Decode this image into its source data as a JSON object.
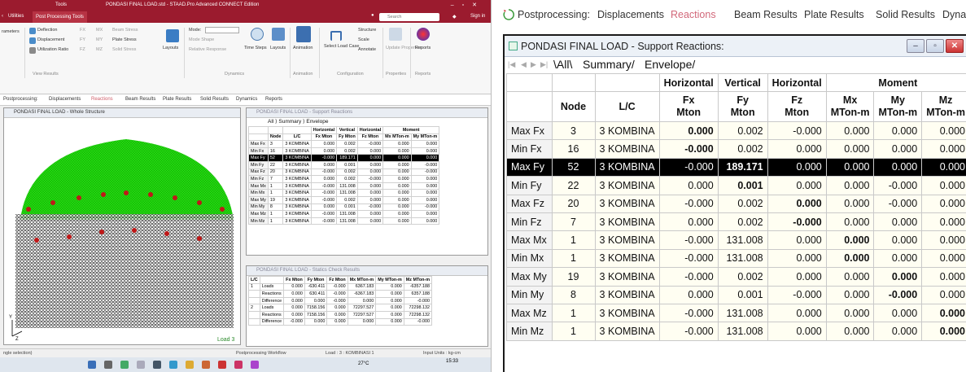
{
  "left": {
    "titlebar": {
      "tools_label": "Tools",
      "title": "PONDASI FINAL LOAD.std - STAAD.Pro Advanced CONNECT Edition"
    },
    "menubar": {
      "utilities": "Utilities",
      "post_processing_tools": "Post Processing Tools",
      "search_placeholder": "Search",
      "sign_in": "Sign in"
    },
    "ribbon": {
      "parameters": "rameters",
      "deflection": "Deflection",
      "displacement": "Displacement",
      "utilization_ratio": "Utilization Ratio",
      "fx": "FX",
      "fy": "FY",
      "mx": "MX",
      "my": "MY",
      "fz": "FZ",
      "mz": "MZ",
      "beam_stress": "Beam Stress",
      "plate_stress": "Plate Stress",
      "solid_stress": "Solid Stress",
      "layouts": "Layouts",
      "mode_label": "Mode:",
      "mode_shape": "Mode Shape",
      "relative_response": "Relative Response",
      "time_steps": "Time Steps",
      "layouts2": "Layouts",
      "animation": "Animation",
      "select_load_case": "Select Load Case",
      "structure": "Structure",
      "scale": "Scale",
      "annotate": "Annotate",
      "update_properties": "Update Properties",
      "reports": "Reports",
      "group_view_results": "View Results",
      "group_dynamics": "Dynamics",
      "group_animation": "Animation",
      "group_configuration": "Configuration",
      "group_properties": "Properties",
      "group_reports": "Reports"
    },
    "subtabs": [
      "Postprocessing:",
      "Displacements",
      "Reactions",
      "Beam Results",
      "Plate Results",
      "Solid Results",
      "Dynamics",
      "Reports"
    ],
    "struct_window_title": "PONDASI FINAL LOAD - Whole Structure",
    "struct_load_label": "Load 3",
    "struct_axis_label": "Y",
    "struct_axis_label2": "Z",
    "react_small_title": "PONDASI FINAL LOAD - Support Reactions",
    "react_small_rows": [
      {
        "label": "Max Fx",
        "node": "3",
        "lc": "3 KOMBINA",
        "fx": "0.000",
        "fy": "0.002",
        "fz": "-0.000",
        "mx": "0.000",
        "my": "0.000"
      },
      {
        "label": "Min Fx",
        "node": "16",
        "lc": "3 KOMBINA",
        "fx": "0.000",
        "fy": "0.002",
        "fz": "0.000",
        "mx": "0.000",
        "my": "0.000"
      },
      {
        "label": "Max Fy",
        "node": "52",
        "lc": "3 KOMBINA",
        "fx": "-0.000",
        "fy": "189.171",
        "fz": "0.000",
        "mx": "0.000",
        "my": "0.000"
      },
      {
        "label": "Min Fy",
        "node": "22",
        "lc": "3 KOMBINA",
        "fx": "0.000",
        "fy": "0.001",
        "fz": "0.000",
        "mx": "0.000",
        "my": "-0.000"
      },
      {
        "label": "Max Fz",
        "node": "20",
        "lc": "3 KOMBINA",
        "fx": "-0.000",
        "fy": "0.002",
        "fz": "0.000",
        "mx": "0.000",
        "my": "-0.000"
      },
      {
        "label": "Min Fz",
        "node": "7",
        "lc": "3 KOMBINA",
        "fx": "0.000",
        "fy": "0.002",
        "fz": "-0.000",
        "mx": "0.000",
        "my": "0.000"
      },
      {
        "label": "Max Mx",
        "node": "1",
        "lc": "3 KOMBINA",
        "fx": "-0.000",
        "fy": "131.008",
        "fz": "0.000",
        "mx": "0.000",
        "my": "0.000"
      },
      {
        "label": "Min Mx",
        "node": "1",
        "lc": "3 KOMBINA",
        "fx": "-0.000",
        "fy": "131.008",
        "fz": "0.000",
        "mx": "0.000",
        "my": "0.000"
      },
      {
        "label": "Max My",
        "node": "19",
        "lc": "3 KOMBINA",
        "fx": "-0.000",
        "fy": "0.002",
        "fz": "0.000",
        "mx": "0.000",
        "my": "0.000"
      },
      {
        "label": "Min My",
        "node": "8",
        "lc": "3 KOMBINA",
        "fx": "0.000",
        "fy": "0.001",
        "fz": "-0.000",
        "mx": "0.000",
        "my": "-0.000"
      },
      {
        "label": "Max Mz",
        "node": "1",
        "lc": "3 KOMBINA",
        "fx": "-0.000",
        "fy": "131.008",
        "fz": "0.000",
        "mx": "0.000",
        "my": "0.000"
      },
      {
        "label": "Min Mz",
        "node": "1",
        "lc": "3 KOMBINA",
        "fx": "-0.000",
        "fy": "131.008",
        "fz": "0.000",
        "mx": "0.000",
        "my": "0.000"
      }
    ],
    "statics_title": "PONDASI FINAL LOAD - Statics Check Results",
    "statics_headers": [
      "L/C",
      "",
      "Fx Mton",
      "Fy Mton",
      "Fz Mton",
      "Mx MTon-m",
      "My MTon-m",
      "Mz MTon-m"
    ],
    "statics_rows": [
      {
        "lc": "1",
        "type": "Loads",
        "fx": "0.000",
        "fy": "-630.411",
        "fz": "-0.000",
        "mx": "6367.183",
        "my": "0.000",
        "mz": "-6357.188"
      },
      {
        "lc": "",
        "type": "Reactions",
        "fx": "0.000",
        "fy": "630.411",
        "fz": "-0.000",
        "mx": "-6367.183",
        "my": "0.000",
        "mz": "6357.188"
      },
      {
        "lc": "",
        "type": "Difference",
        "fx": "0.000",
        "fy": "0.000",
        "fz": "-0.000",
        "mx": "0.000",
        "my": "0.000",
        "mz": "-0.000"
      },
      {
        "lc": "2",
        "type": "Loads",
        "fx": "0.000",
        "fy": "7158.156",
        "fz": "0.000",
        "mx": "72297.527",
        "my": "0.000",
        "mz": "72298.132"
      },
      {
        "lc": "",
        "type": "Reactions",
        "fx": "0.000",
        "fy": "7158.156",
        "fz": "0.000",
        "mx": "72297.527",
        "my": "0.000",
        "mz": "72298.132"
      },
      {
        "lc": "",
        "type": "Difference",
        "fx": "-0.000",
        "fy": "0.000",
        "fz": "0.000",
        "mx": "0.000",
        "my": "0.000",
        "mz": "-0.000"
      }
    ],
    "status": {
      "selection": "ngle selection)",
      "workflow": "Postprocessing Workflow",
      "load": "Load : 3 : KOMBINASI 1",
      "units": "Input Units : kg-cm"
    },
    "taskbar": {
      "temp": "27°C",
      "time": "15:33"
    }
  },
  "right": {
    "tabs": [
      "Postprocessing:",
      "Displacements",
      "Reactions",
      "Beam Results",
      "Plate Results",
      "Solid Results",
      "Dynamic"
    ],
    "window_title": "PONDASI FINAL LOAD - Support Reactions:",
    "sheet_tabs": [
      "All",
      "Summary",
      "Envelope"
    ],
    "header_groups": [
      "Horizontal",
      "Vertical",
      "Horizontal",
      "Moment"
    ],
    "headers": [
      "Node",
      "L/C",
      "Fx\nMton",
      "Fy\nMton",
      "Fz\nMton",
      "Mx\nMTon-m",
      "My\nMTon-m",
      "Mz\nMTon-m"
    ],
    "rows": [
      {
        "label": "Max Fx",
        "node": "3",
        "lc": "3 KOMBINA",
        "fx": "0.000",
        "fy": "0.002",
        "fz": "-0.000",
        "mx": "0.000",
        "my": "0.000",
        "mz": "0.000",
        "bold": "fx"
      },
      {
        "label": "Min Fx",
        "node": "16",
        "lc": "3 KOMBINA",
        "fx": "-0.000",
        "fy": "0.002",
        "fz": "0.000",
        "mx": "0.000",
        "my": "0.000",
        "mz": "0.000",
        "bold": "fx"
      },
      {
        "label": "Max Fy",
        "node": "52",
        "lc": "3 KOMBINA",
        "fx": "-0.000",
        "fy": "189.171",
        "fz": "0.000",
        "mx": "0.000",
        "my": "0.000",
        "mz": "0.000",
        "bold": "fy"
      },
      {
        "label": "Min Fy",
        "node": "22",
        "lc": "3 KOMBINA",
        "fx": "0.000",
        "fy": "0.001",
        "fz": "0.000",
        "mx": "0.000",
        "my": "-0.000",
        "mz": "0.000",
        "bold": "fy"
      },
      {
        "label": "Max Fz",
        "node": "20",
        "lc": "3 KOMBINA",
        "fx": "-0.000",
        "fy": "0.002",
        "fz": "0.000",
        "mx": "0.000",
        "my": "-0.000",
        "mz": "0.000",
        "bold": "fz"
      },
      {
        "label": "Min Fz",
        "node": "7",
        "lc": "3 KOMBINA",
        "fx": "0.000",
        "fy": "0.002",
        "fz": "-0.000",
        "mx": "0.000",
        "my": "0.000",
        "mz": "0.000",
        "bold": "fz"
      },
      {
        "label": "Max Mx",
        "node": "1",
        "lc": "3 KOMBINA",
        "fx": "-0.000",
        "fy": "131.008",
        "fz": "0.000",
        "mx": "0.000",
        "my": "0.000",
        "mz": "0.000",
        "bold": "mx"
      },
      {
        "label": "Min Mx",
        "node": "1",
        "lc": "3 KOMBINA",
        "fx": "-0.000",
        "fy": "131.008",
        "fz": "0.000",
        "mx": "0.000",
        "my": "0.000",
        "mz": "0.000",
        "bold": "mx"
      },
      {
        "label": "Max My",
        "node": "19",
        "lc": "3 KOMBINA",
        "fx": "-0.000",
        "fy": "0.002",
        "fz": "0.000",
        "mx": "0.000",
        "my": "0.000",
        "mz": "0.000",
        "bold": "my"
      },
      {
        "label": "Min My",
        "node": "8",
        "lc": "3 KOMBINA",
        "fx": "0.000",
        "fy": "0.001",
        "fz": "-0.000",
        "mx": "0.000",
        "my": "-0.000",
        "mz": "0.000",
        "bold": "my"
      },
      {
        "label": "Max Mz",
        "node": "1",
        "lc": "3 KOMBINA",
        "fx": "-0.000",
        "fy": "131.008",
        "fz": "0.000",
        "mx": "0.000",
        "my": "0.000",
        "mz": "0.000",
        "bold": "mz"
      },
      {
        "label": "Min Mz",
        "node": "1",
        "lc": "3 KOMBINA",
        "fx": "-0.000",
        "fy": "131.008",
        "fz": "0.000",
        "mx": "0.000",
        "my": "0.000",
        "mz": "0.000",
        "bold": "mz"
      }
    ],
    "selected_row": "Max Fy"
  },
  "colors": {
    "title_bar": "#9b1b2e",
    "active_tab": "#d2687a",
    "selected_row": "#000000",
    "cell_bg": "#fffef2",
    "structure_green": "#22dd11"
  },
  "icons": [
    "reactions-tab-icon",
    "window-icon",
    "minimize-icon",
    "restore-icon",
    "close-icon",
    "first-sheet-icon",
    "prev-sheet-icon",
    "next-sheet-icon",
    "last-sheet-icon"
  ]
}
